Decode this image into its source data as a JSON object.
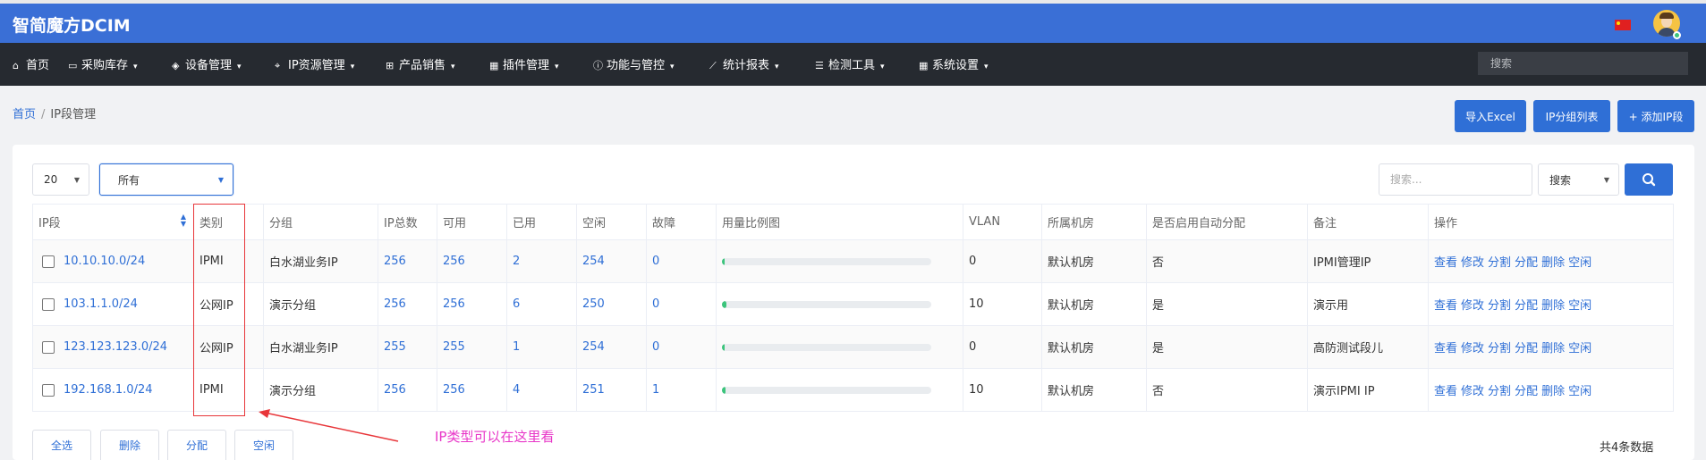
{
  "app": {
    "title": "智简魔方DCIM"
  },
  "nav": {
    "items": [
      {
        "label": "首页",
        "icon": "home-icon",
        "glyph": "⌂",
        "has_menu": false
      },
      {
        "label": "采购库存",
        "icon": "truck-icon",
        "glyph": "▭",
        "has_menu": true
      },
      {
        "label": "设备管理",
        "icon": "cube-icon",
        "glyph": "◈",
        "has_menu": true
      },
      {
        "label": "IP资源管理",
        "icon": "map-marker-icon",
        "glyph": "⌖",
        "has_menu": true
      },
      {
        "label": "产品销售",
        "icon": "cart-icon",
        "glyph": "⊞",
        "has_menu": true
      },
      {
        "label": "插件管理",
        "icon": "grid-icon",
        "glyph": "▦",
        "has_menu": true
      },
      {
        "label": "功能与管控",
        "icon": "info-circle-icon",
        "glyph": "ⓘ",
        "has_menu": true
      },
      {
        "label": "统计报表",
        "icon": "line-chart-icon",
        "glyph": "⟋",
        "has_menu": true
      },
      {
        "label": "检测工具",
        "icon": "list-icon",
        "glyph": "☰",
        "has_menu": true
      },
      {
        "label": "系统设置",
        "icon": "grid-settings-icon",
        "glyph": "▦",
        "has_menu": true
      }
    ],
    "search_placeholder": "搜索"
  },
  "breadcrumb": {
    "home": "首页",
    "separator": "/",
    "current": "IP段管理"
  },
  "actions": {
    "import": "导入Excel",
    "group_list": "IP分组列表",
    "add": "+ 添加IP段"
  },
  "filters": {
    "page_size": "20",
    "type_filter": "所有",
    "search_placeholder": "搜索...",
    "search_field": "搜索"
  },
  "table": {
    "headers": [
      "IP段",
      "类别",
      "分组",
      "IP总数",
      "可用",
      "已用",
      "空闲",
      "故障",
      "用量比例图",
      "VLAN",
      "所属机房",
      "是否启用自动分配",
      "备注",
      "操作"
    ],
    "rows": [
      {
        "ip": "10.10.10.0/24",
        "type": "IPMI",
        "group": "白水湖业务IP",
        "total": "256",
        "available": "256",
        "used": "2",
        "free": "254",
        "fault": "0",
        "usage": 0.0078,
        "vlan": "0",
        "room": "默认机房",
        "auto": "否",
        "note": "IPMI管理IP"
      },
      {
        "ip": "103.1.1.0/24",
        "type": "公网IP",
        "group": "演示分组",
        "total": "256",
        "available": "256",
        "used": "6",
        "free": "250",
        "fault": "0",
        "usage": 0.0234,
        "vlan": "10",
        "room": "默认机房",
        "auto": "是",
        "note": "演示用"
      },
      {
        "ip": "123.123.123.0/24",
        "type": "公网IP",
        "group": "白水湖业务IP",
        "total": "255",
        "available": "255",
        "used": "1",
        "free": "254",
        "fault": "0",
        "usage": 0.0039,
        "vlan": "0",
        "room": "默认机房",
        "auto": "是",
        "note": "高防测试段儿"
      },
      {
        "ip": "192.168.1.0/24",
        "type": "IPMI",
        "group": "演示分组",
        "total": "256",
        "available": "256",
        "used": "4",
        "free": "251",
        "fault": "1",
        "usage": 0.0156,
        "vlan": "10",
        "room": "默认机房",
        "auto": "否",
        "note": "演示IPMI IP"
      }
    ],
    "row_actions": [
      "查看",
      "修改",
      "分割",
      "分配",
      "删除",
      "空闲"
    ]
  },
  "bulk": {
    "select_all": "全选",
    "delete": "删除",
    "assign": "分配",
    "free": "空闲"
  },
  "footer": {
    "total": "共4条数据"
  },
  "annotation": {
    "text": "IP类型可以在这里看"
  },
  "colors": {
    "primary": "#2f6fd6",
    "topbar": "#3a6fd6",
    "navbar": "#262a30",
    "annotation": "#e836c8",
    "highlight": "#e8363a",
    "usage_bar": "#3cc47c"
  }
}
